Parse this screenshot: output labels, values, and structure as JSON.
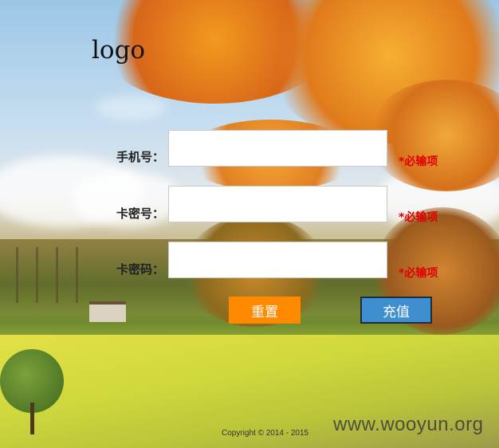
{
  "header": {
    "logo_text": "logo"
  },
  "form": {
    "phone": {
      "label": "手机号：",
      "value": "",
      "required_text": "*必输项"
    },
    "card_password": {
      "label": "卡密号：",
      "value": "",
      "required_text": "*必输项"
    },
    "card_code": {
      "label": "卡密码：",
      "value": "",
      "required_text": "*必输项"
    },
    "reset_label": "重置",
    "submit_label": "充值"
  },
  "footer": {
    "copyright": "Copyright © 2014 - 2015"
  },
  "watermark": "www.wooyun.org",
  "colors": {
    "reset_button": "#ff8a00",
    "submit_button": "#3f8fd0",
    "required": "#e00000"
  }
}
